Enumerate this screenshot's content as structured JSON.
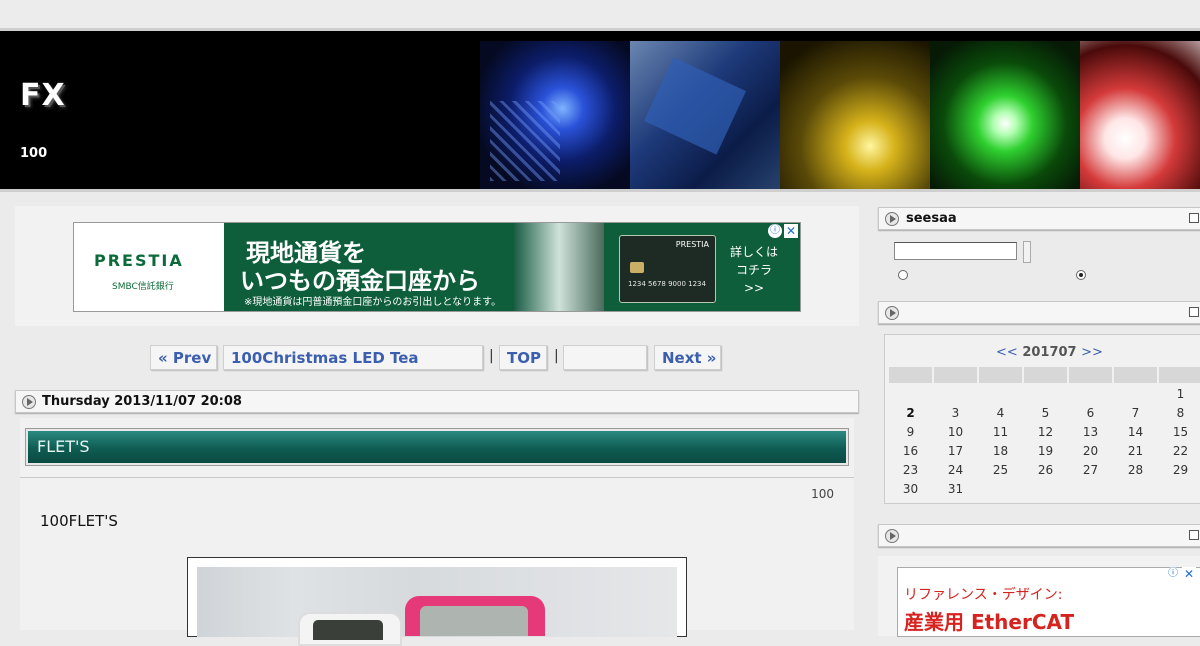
{
  "header": {
    "site_title": "FX",
    "site_description": "100",
    "photos": [
      "blue-pc-led-photo",
      "blue-glass-photo",
      "yellow-candle-photo",
      "green-led-photo",
      "red-flashlight-photo"
    ]
  },
  "ad_banner": {
    "logo": "PRESTIA",
    "logo_sub": "SMBC信託銀行",
    "headline_line1": "現地通貨を",
    "headline_line2": "いつもの預金口座から",
    "note": "※現地通貨は円普通預金口座からのお引出しとなります。",
    "card_name": "PRESTIA",
    "card_number": "1234 5678 9000 1234",
    "cta": "詳しくは\nコチラ\n>>",
    "info_icon": "ⓘ",
    "close_icon": "✕"
  },
  "pager": {
    "prev": "« Prev",
    "current_title": "100Christmas LED  Tea",
    "separator": "|",
    "top": "TOP",
    "blank": "",
    "next": "Next »"
  },
  "post": {
    "date": "Thursday 2013/11/07 20:08",
    "title": "FLET'S",
    "meta": "100",
    "body": "100FLET'S"
  },
  "sidebar": {
    "search_title": "seesaa",
    "search_value": "",
    "radios": [
      {
        "selected": false
      },
      {
        "selected": true
      }
    ],
    "calendar_title": "",
    "calendar": {
      "prev": "<<",
      "month": "201707",
      "next": ">>",
      "weeks": [
        [
          "",
          "",
          "",
          "",
          "",
          "",
          "1"
        ],
        [
          "2",
          "3",
          "4",
          "5",
          "6",
          "7",
          "8"
        ],
        [
          "9",
          "10",
          "11",
          "12",
          "13",
          "14",
          "15"
        ],
        [
          "16",
          "17",
          "18",
          "19",
          "20",
          "21",
          "22"
        ],
        [
          "23",
          "24",
          "25",
          "26",
          "27",
          "28",
          "29"
        ],
        [
          "30",
          "31",
          "",
          "",
          "",
          "",
          ""
        ]
      ]
    },
    "ad_title": "",
    "ad_line1": "リファレンス・デザイン:",
    "ad_line2": "産業用 EtherCAT"
  },
  "colors": {
    "title_banner": "#0f5c52",
    "link": "#3b5fae",
    "ad_green": "#0f5e3b",
    "ad_red": "#d6231f"
  }
}
